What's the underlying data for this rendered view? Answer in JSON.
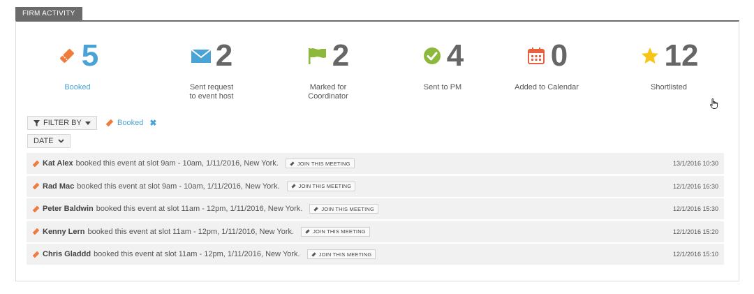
{
  "panel": {
    "tab_label": "FIRM ACTIVITY"
  },
  "colors": {
    "orange": "#ef7b3c",
    "blue": "#4aa3d6",
    "green": "#8cb83c",
    "red": "#e8613f",
    "yellow": "#f5c518"
  },
  "stats": [
    {
      "icon": "ticket-icon",
      "count": "5",
      "label": "Booked",
      "active": true
    },
    {
      "icon": "envelope-icon",
      "count": "2",
      "label": "Sent request\nto event host",
      "active": false
    },
    {
      "icon": "flag-icon",
      "count": "2",
      "label": "Marked for\nCoordinator",
      "active": false
    },
    {
      "icon": "check-circle-icon",
      "count": "4",
      "label": "Sent to PM",
      "active": false
    },
    {
      "icon": "calendar-icon",
      "count": "0",
      "label": "Added to Calendar",
      "active": false
    },
    {
      "icon": "star-icon",
      "count": "12",
      "label": "Shortlisted",
      "active": false
    }
  ],
  "filters": {
    "filter_by_label": "FILTER BY",
    "active_filter": "Booked",
    "date_label": "DATE"
  },
  "activity": [
    {
      "name": "Kat Alex",
      "text": "booked this event at slot 9am - 10am, 1/11/2016, New York.",
      "button": "JOIN THIS MEETING",
      "time": "13/1/2016 10:30"
    },
    {
      "name": "Rad Mac",
      "text": "booked this event at slot 9am - 10am, 1/11/2016, New York.",
      "button": "JOIN THIS MEETING",
      "time": "12/1/2016 16:30"
    },
    {
      "name": "Peter Baldwin",
      "text": "booked this event at slot 11am - 12pm, 1/11/2016, New York.",
      "button": "JOIN THIS MEETING",
      "time": "12/1/2016 15:30"
    },
    {
      "name": "Kenny Lern",
      "text": "booked this event at slot 11am - 12pm, 1/11/2016, New York.",
      "button": "JOIN THIS MEETING",
      "time": "12/1/2016 15:20"
    },
    {
      "name": "Chris Gladdd",
      "text": "booked this event at slot 11am - 12pm, 1/11/2016, New York.",
      "button": "JOIN THIS MEETING",
      "time": "12/1/2016 15:10"
    }
  ]
}
